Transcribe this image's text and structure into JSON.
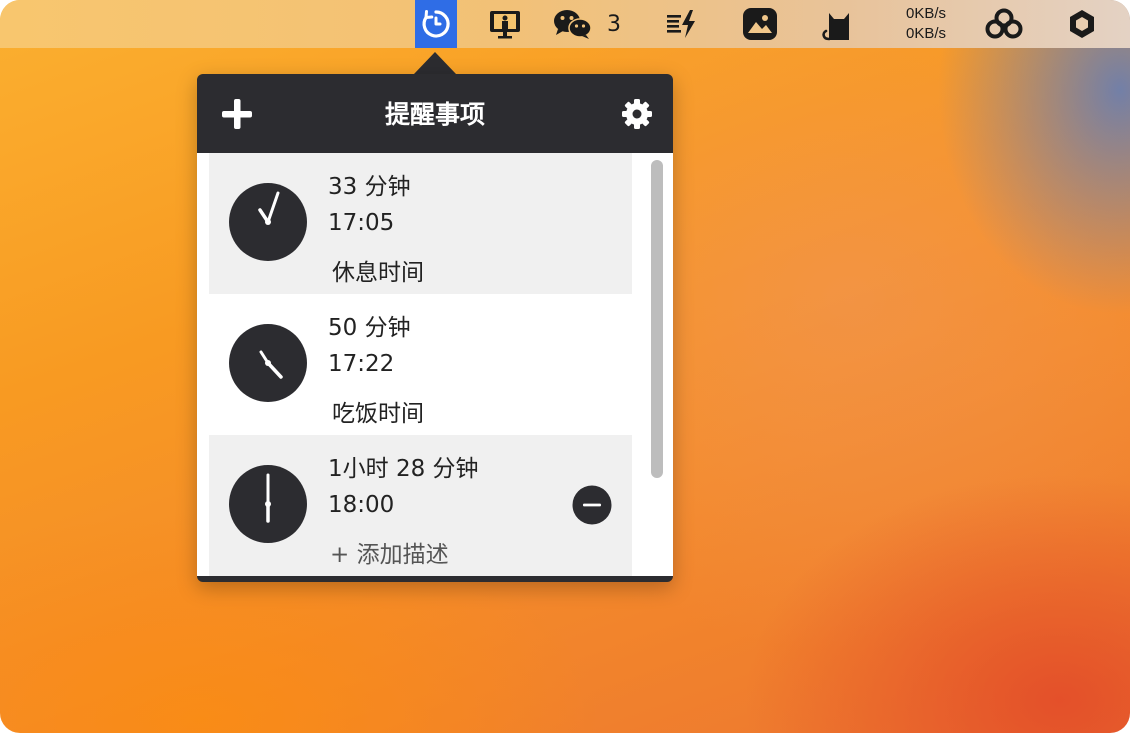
{
  "menubar": {
    "wechat_badge": "3",
    "net_up": "0KB/s",
    "net_down": "0KB/s",
    "icons": [
      "reminder-app-icon",
      "presenter-icon",
      "wechat-icon",
      "battery-charging-icon",
      "image-icon",
      "cat-icon",
      "network-speed",
      "triple-circle-icon",
      "hexagon-icon"
    ],
    "active_color": "#2f6de6"
  },
  "popover": {
    "title": "提醒事项",
    "add_icon": "plus-icon",
    "settings_icon": "gear-icon",
    "header_color": "#2c2c30",
    "reminders": [
      {
        "remaining": "33 分钟",
        "time": "17:05",
        "label": "休息时间"
      },
      {
        "remaining": "50 分钟",
        "time": "17:22",
        "label": "吃饭时间"
      },
      {
        "remaining": "1小时 28 分钟",
        "time": "18:00",
        "label": "+ 添加描述"
      }
    ]
  }
}
